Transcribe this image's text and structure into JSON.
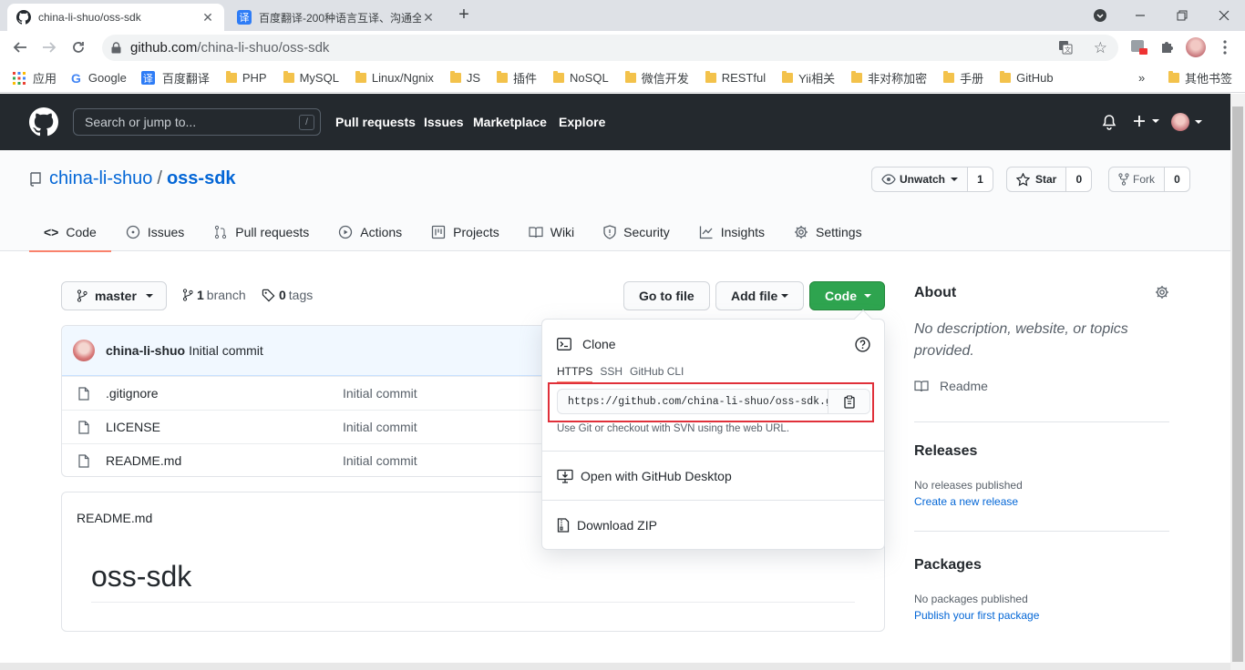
{
  "browser": {
    "tabs": [
      {
        "title": "china-li-shuo/oss-sdk",
        "active": true
      },
      {
        "title": "百度翻译-200种语言互译、沟通全",
        "active": false
      }
    ],
    "new_tab": "+",
    "omnibox": {
      "host": "github.com",
      "path": "/china-li-shuo/oss-sdk"
    },
    "bookmarks": [
      {
        "label": "应用",
        "icon": "apps-grid-icon"
      },
      {
        "label": "Google",
        "icon": "google-icon"
      },
      {
        "label": "百度翻译",
        "icon": "baidu-translate-icon"
      },
      {
        "label": "PHP",
        "icon": "folder-icon"
      },
      {
        "label": "MySQL",
        "icon": "folder-icon"
      },
      {
        "label": "Linux/Ngnix",
        "icon": "folder-icon"
      },
      {
        "label": "JS",
        "icon": "folder-icon"
      },
      {
        "label": "插件",
        "icon": "folder-icon"
      },
      {
        "label": "NoSQL",
        "icon": "folder-icon"
      },
      {
        "label": "微信开发",
        "icon": "folder-icon"
      },
      {
        "label": "RESTful",
        "icon": "folder-icon"
      },
      {
        "label": "Yii相关",
        "icon": "folder-icon"
      },
      {
        "label": "非对称加密",
        "icon": "folder-icon"
      },
      {
        "label": "手册",
        "icon": "folder-icon"
      },
      {
        "label": "GitHub",
        "icon": "folder-icon"
      }
    ],
    "bookmarks_more": "»",
    "other_bookmarks": "其他书签"
  },
  "github": {
    "search_placeholder": "Search or jump to...",
    "search_shortcut": "/",
    "nav": [
      "Pull requests",
      "Issues",
      "Marketplace",
      "Explore"
    ]
  },
  "repo": {
    "owner": "china-li-shuo",
    "separator": "/",
    "name": "oss-sdk",
    "unwatch": {
      "label": "Unwatch",
      "count": "1"
    },
    "star": {
      "label": "Star",
      "count": "0"
    },
    "fork": {
      "label": "Fork",
      "count": "0"
    },
    "tabs": [
      "Code",
      "Issues",
      "Pull requests",
      "Actions",
      "Projects",
      "Wiki",
      "Security",
      "Insights",
      "Settings"
    ]
  },
  "main": {
    "branch": "master",
    "branch_count": "1",
    "branch_label": "branch",
    "tag_count": "0",
    "tag_label": "tags",
    "go_to_file": "Go to file",
    "add_file": "Add file",
    "code": "Code",
    "commit": {
      "author": "china-li-shuo",
      "message": "Initial commit"
    },
    "files": [
      {
        "name": ".gitignore",
        "message": "Initial commit"
      },
      {
        "name": "LICENSE",
        "message": "Initial commit"
      },
      {
        "name": "README.md",
        "message": "Initial commit"
      }
    ],
    "readme": {
      "file": "README.md",
      "heading": "oss-sdk"
    }
  },
  "clone": {
    "title": "Clone",
    "tabs": [
      "HTTPS",
      "SSH",
      "GitHub CLI"
    ],
    "url": "https://github.com/china-li-shuo/oss-sdk.git",
    "hint": "Use Git or checkout with SVN using the web URL.",
    "open_desktop": "Open with GitHub Desktop",
    "download_zip": "Download ZIP"
  },
  "about": {
    "title": "About",
    "description": "No description, website, or topics provided.",
    "readme": "Readme",
    "releases_title": "Releases",
    "releases_text": "No releases published",
    "releases_link": "Create a new release",
    "packages_title": "Packages",
    "packages_text": "No packages published",
    "packages_link": "Publish your first package"
  },
  "colors": {
    "header": "#24292e",
    "link": "#0366d6",
    "code_button": "#2ea44f",
    "tab_underline": "#f9826c",
    "highlight": "#e0303a"
  }
}
